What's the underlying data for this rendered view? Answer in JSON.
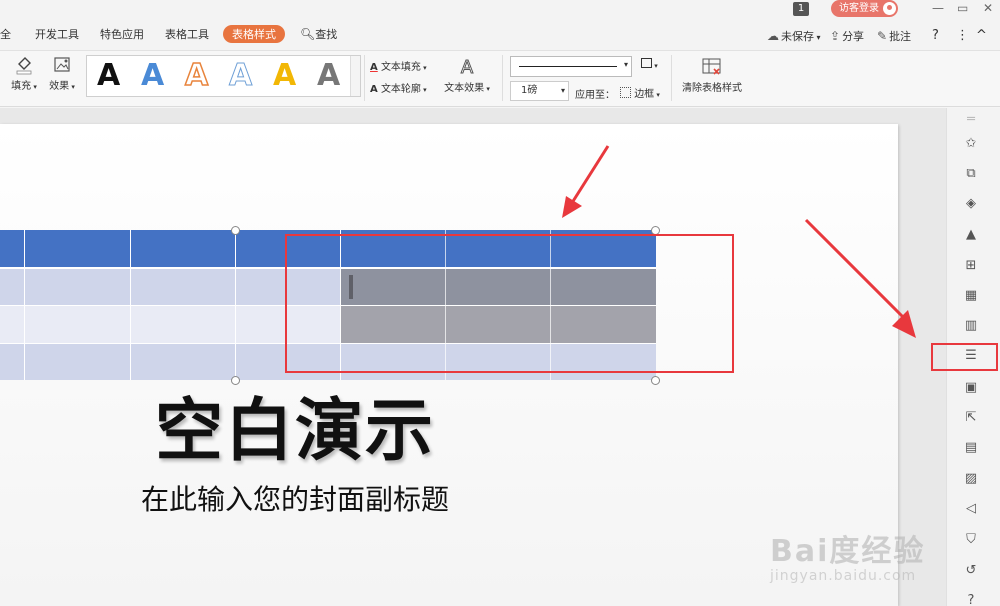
{
  "titlebar": {
    "badge": "1",
    "login_label": "访客登录",
    "controls": [
      "—",
      "▭",
      "✕"
    ]
  },
  "tabs": [
    {
      "label": "全"
    },
    {
      "label": "开发工具"
    },
    {
      "label": "特色应用"
    },
    {
      "label": "表格工具"
    },
    {
      "label": "表格样式",
      "active": true
    },
    {
      "label": "查找"
    }
  ],
  "right_tools": {
    "unsaved": "未保存",
    "share": "分享",
    "comment": "批注",
    "help": "?",
    "more": "⋮",
    "collapse": "^"
  },
  "ribbon": {
    "fill": "填充",
    "effect": "效果",
    "gallery_letter": "A",
    "gallery_colors": [
      "#111111",
      "#4a8ad6",
      "#e8843c",
      "#6e9fd6",
      "#f2b705",
      "#777777"
    ],
    "text_fill": "文本填充",
    "text_outline": "文本轮廓",
    "text_effect": "文本效果",
    "line_weight": "1磅",
    "apply_to": "应用至：",
    "border": "边框",
    "clear_style": "清除表格样式"
  },
  "slide": {
    "title": "空白演示",
    "subtitle": "在此输入您的封面副标题"
  },
  "table_style": {
    "header_color": "#4472c4",
    "band1_color": "#cfd5ea",
    "band2_color": "#e9ebf5",
    "selected_color": "#8e929f"
  },
  "sidebar": {
    "icons": [
      "list-icon",
      "star-icon",
      "shapes-icon",
      "layers-icon",
      "pen-icon",
      "table-icon",
      "grid-icon",
      "bar-chart-icon",
      "sliders-icon",
      "image-search-icon",
      "export-icon",
      "archive-icon",
      "image-icon",
      "speaker-icon",
      "shield-icon",
      "history-icon",
      "help-icon"
    ]
  },
  "watermark": {
    "brand": "Bai度经验",
    "url": "jingyan.baidu.com"
  }
}
